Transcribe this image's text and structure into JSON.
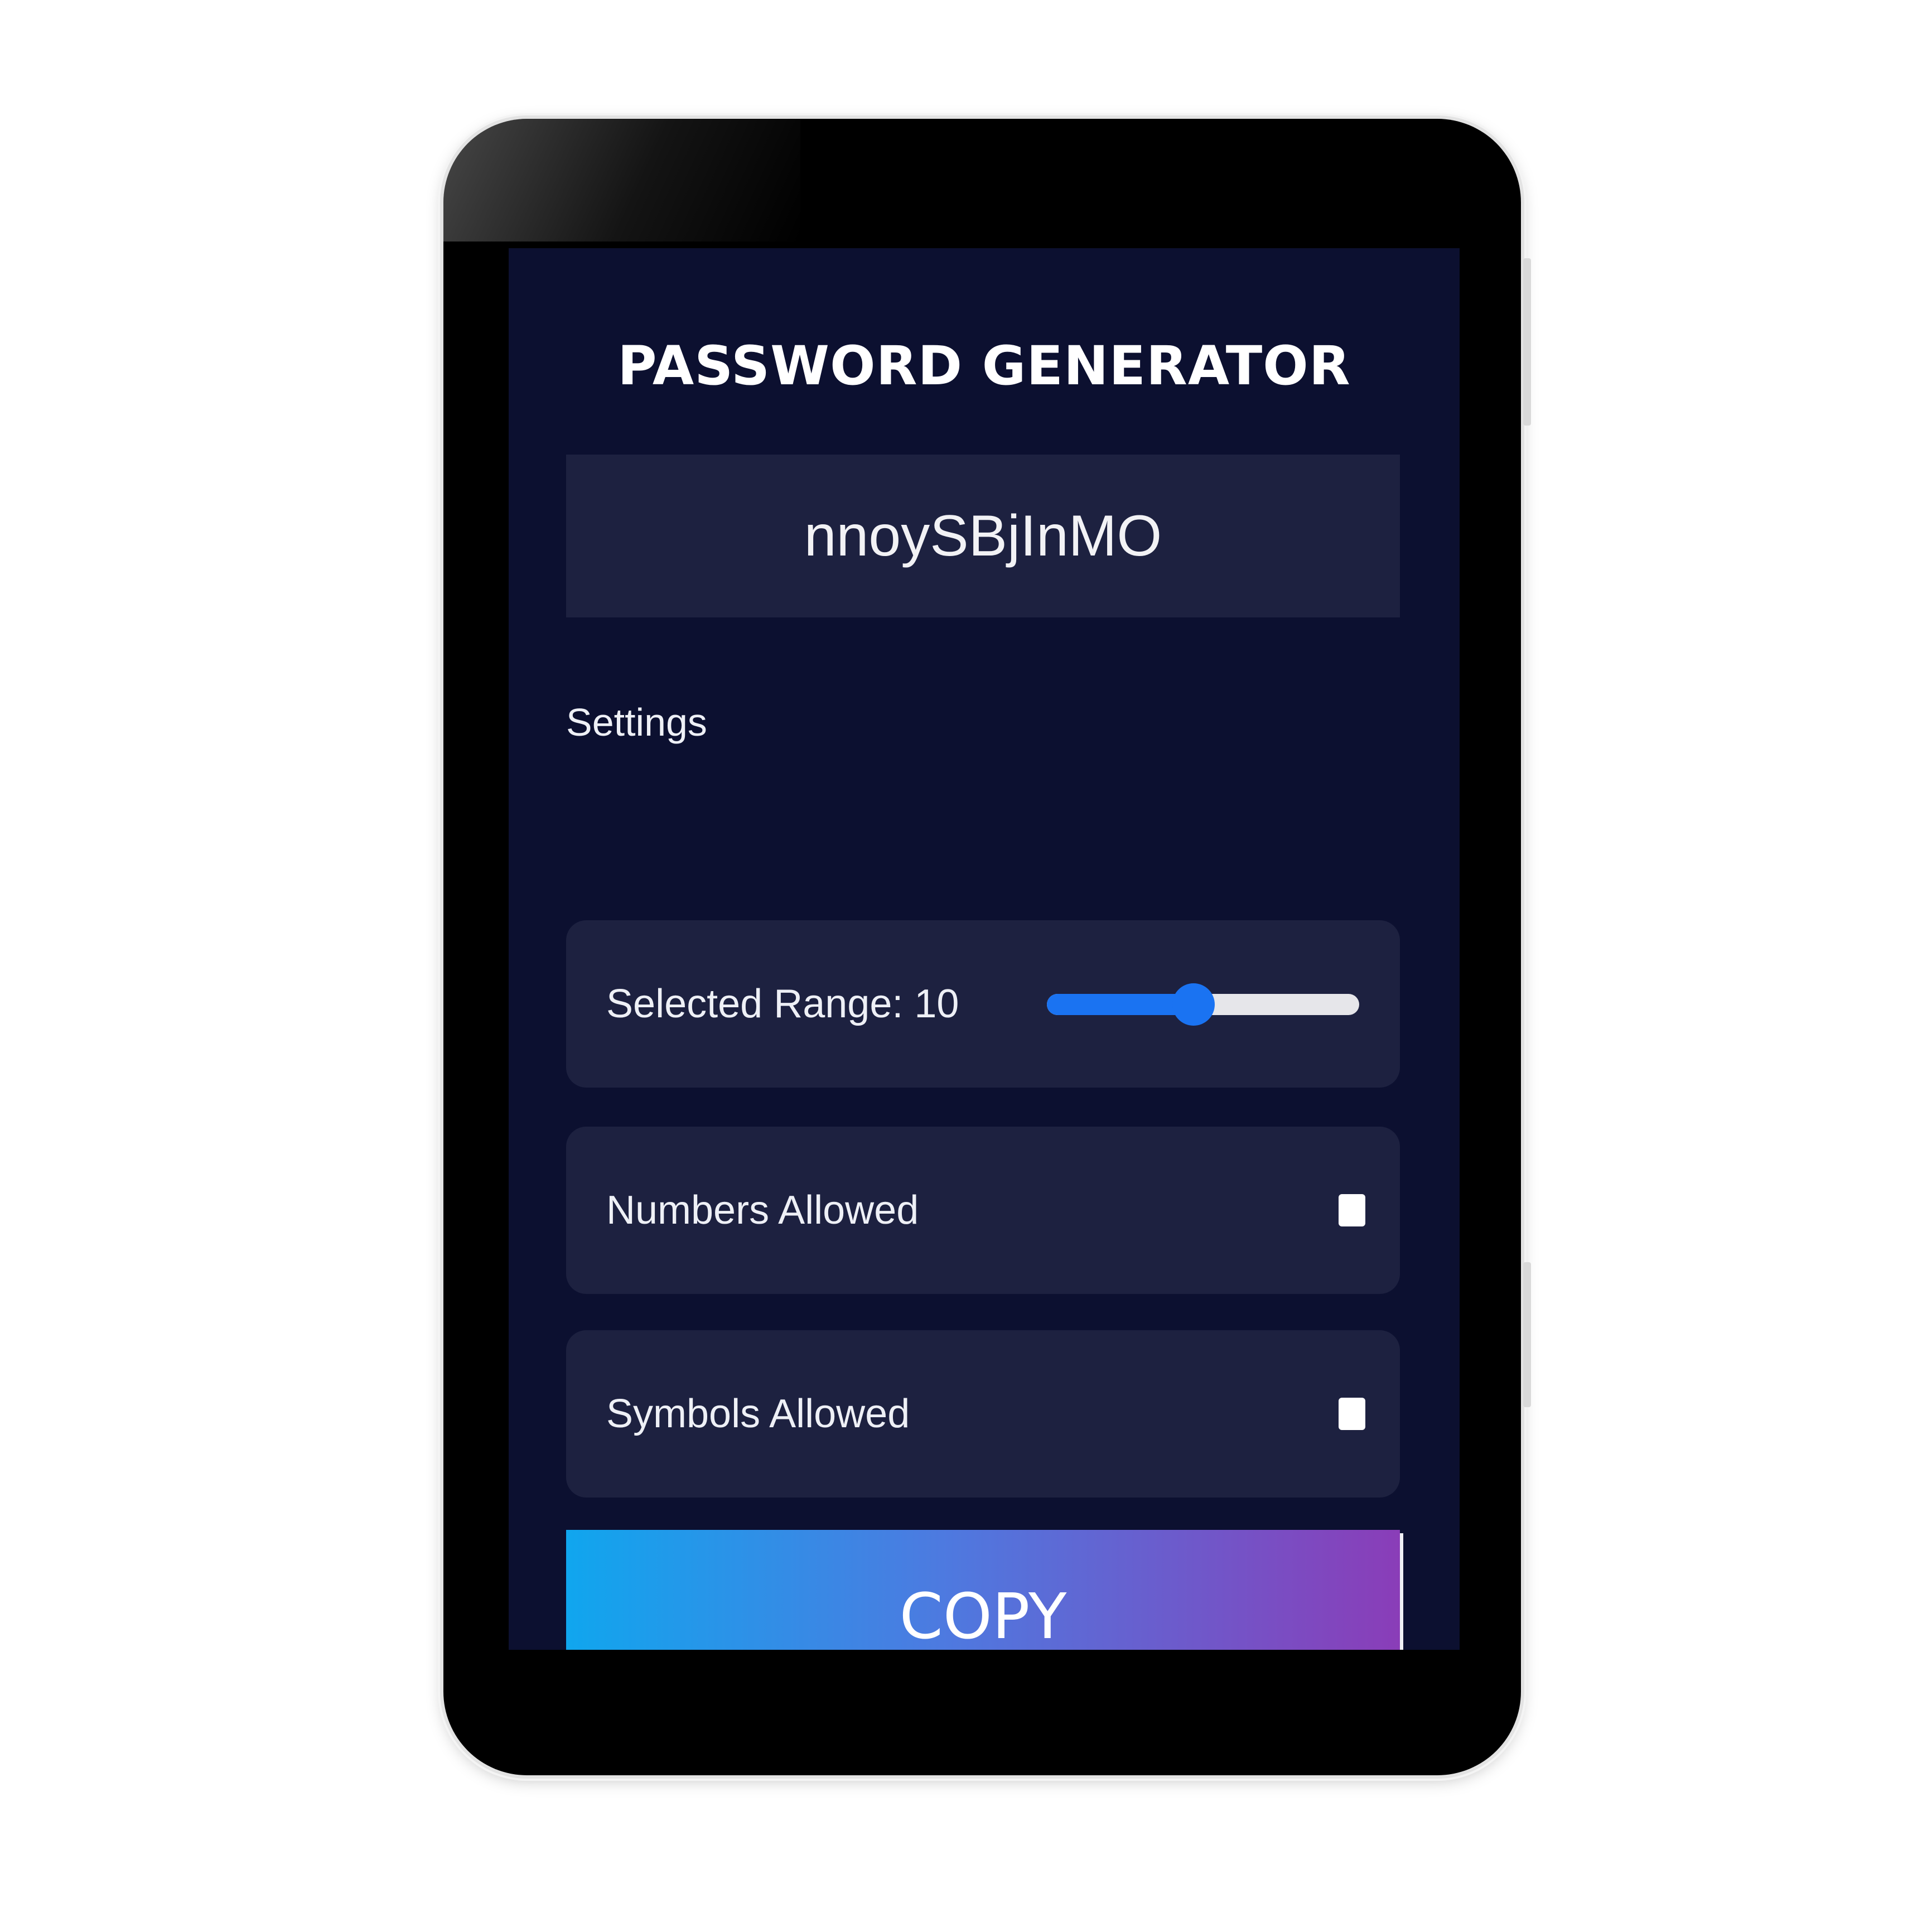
{
  "app": {
    "title": "PASSWORD GENERATOR"
  },
  "password": {
    "value": "nnoySBjInMO"
  },
  "settings": {
    "heading": "Settings",
    "range": {
      "label": "Selected Range: 10",
      "fill_fraction": 0.47
    },
    "numbers": {
      "label": "Numbers Allowed",
      "checked": false
    },
    "symbols": {
      "label": "Symbols Allowed",
      "checked": false
    }
  },
  "actions": {
    "copy_label": "COPY"
  },
  "colors": {
    "background": "#0c1030",
    "panel": "#1d2140",
    "accent": "#1a73f2",
    "gradient_start": "#10a6ee",
    "gradient_end": "#8a3db8"
  },
  "icons": {
    "checkbox": "unchecked-checkbox-icon"
  }
}
